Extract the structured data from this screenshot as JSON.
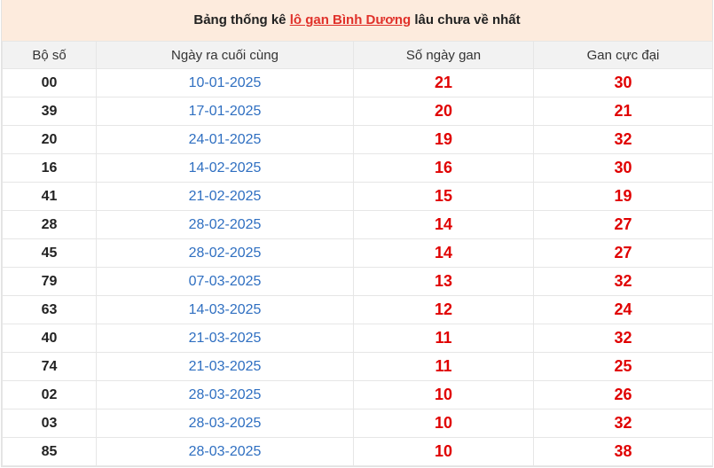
{
  "title": {
    "prefix": "Bảng thống kê ",
    "highlight": "lô gan Bình Dương",
    "suffix": " lâu chưa về nhất"
  },
  "headers": [
    "Bộ số",
    "Ngày ra cuối cùng",
    "Số ngày gan",
    "Gan cực đại"
  ],
  "rows": [
    {
      "so": "00",
      "ngay": "10-01-2025",
      "gan": "21",
      "max": "30"
    },
    {
      "so": "39",
      "ngay": "17-01-2025",
      "gan": "20",
      "max": "21"
    },
    {
      "so": "20",
      "ngay": "24-01-2025",
      "gan": "19",
      "max": "32"
    },
    {
      "so": "16",
      "ngay": "14-02-2025",
      "gan": "16",
      "max": "30"
    },
    {
      "so": "41",
      "ngay": "21-02-2025",
      "gan": "15",
      "max": "19"
    },
    {
      "so": "28",
      "ngay": "28-02-2025",
      "gan": "14",
      "max": "27"
    },
    {
      "so": "45",
      "ngay": "28-02-2025",
      "gan": "14",
      "max": "27"
    },
    {
      "so": "79",
      "ngay": "07-03-2025",
      "gan": "13",
      "max": "32"
    },
    {
      "so": "63",
      "ngay": "14-03-2025",
      "gan": "12",
      "max": "24"
    },
    {
      "so": "40",
      "ngay": "21-03-2025",
      "gan": "11",
      "max": "32"
    },
    {
      "so": "74",
      "ngay": "21-03-2025",
      "gan": "11",
      "max": "25"
    },
    {
      "so": "02",
      "ngay": "28-03-2025",
      "gan": "10",
      "max": "26"
    },
    {
      "so": "03",
      "ngay": "28-03-2025",
      "gan": "10",
      "max": "32"
    },
    {
      "so": "85",
      "ngay": "28-03-2025",
      "gan": "10",
      "max": "38"
    }
  ],
  "colors": {
    "title_bg": "#fdebdd",
    "highlight": "#e0312a",
    "date": "#2f6fc1",
    "gan": "#e00000"
  }
}
